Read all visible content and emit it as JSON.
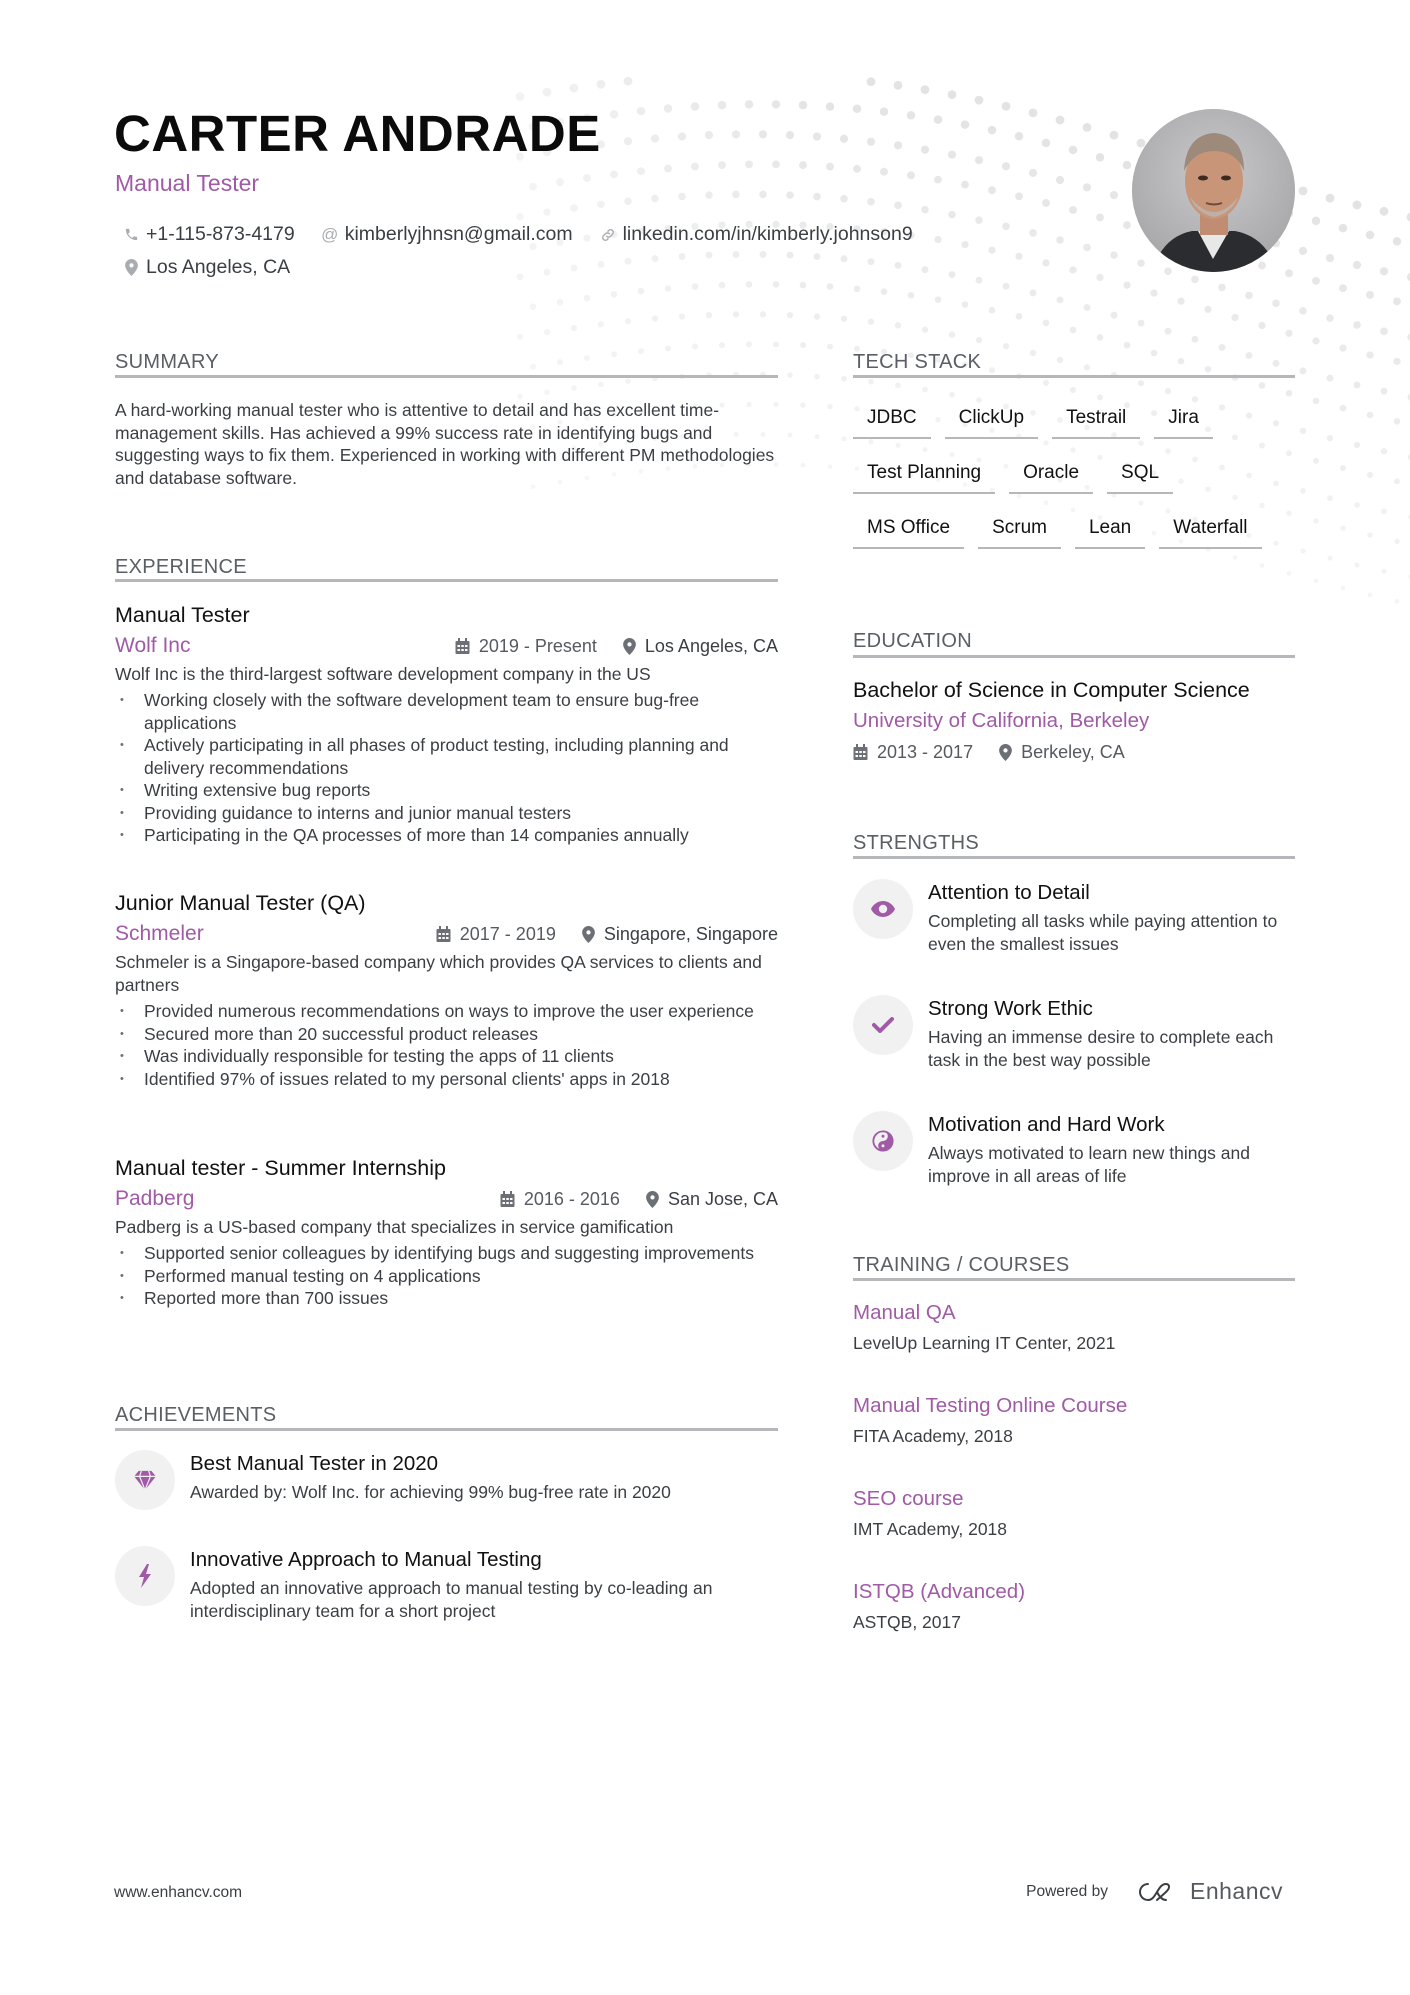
{
  "header": {
    "name": "CARTER ANDRADE",
    "title": "Manual Tester",
    "contacts": {
      "phone": "+1-115-873-4179",
      "email": "kimberlyjhnsn@gmail.com",
      "linkedin": "linkedin.com/in/kimberly.johnson9",
      "location": "Los Angeles, CA"
    },
    "photo_alt": "Profile photo"
  },
  "colors": {
    "accent": "#a05aa6",
    "heading_line": "#b5b7ba",
    "icon_circle": "#f1f1f2"
  },
  "summary": {
    "heading": "SUMMARY",
    "text": "A hard-working manual tester who is attentive to detail and has excellent time-management skills. Has achieved a 99% success rate in identifying bugs and suggesting ways to fix them. Experienced in working with different PM methodologies and database software."
  },
  "experience": {
    "heading": "EXPERIENCE",
    "items": [
      {
        "role": "Manual Tester",
        "company": "Wolf Inc",
        "dates": "2019 - Present",
        "location": "Los Angeles, CA",
        "description": "Wolf Inc is the third-largest software development company in the US",
        "bullets": [
          "Working closely with the software development team to ensure bug-free applications",
          "Actively participating in all phases of product testing, including planning and delivery recommendations",
          "Writing extensive bug reports",
          "Providing guidance to interns and junior manual testers",
          "Participating in the QA processes of more than 14 companies annually"
        ]
      },
      {
        "role": "Junior Manual Tester (QA)",
        "company": "Schmeler",
        "dates": "2017 - 2019",
        "location": "Singapore, Singapore",
        "description": "Schmeler is a Singapore-based company which provides QA services to clients and partners",
        "bullets": [
          "Provided numerous recommendations on ways to improve the user experience",
          "Secured more than 20 successful product releases",
          "Was individually responsible for testing the apps of 11 clients",
          "Identified 97% of issues related to my personal clients' apps in 2018"
        ]
      },
      {
        "role": "Manual tester - Summer Internship",
        "company": "Padberg",
        "dates": "2016 - 2016",
        "location": "San Jose, CA",
        "description": "Padberg is a US-based company that specializes in service gamification",
        "bullets": [
          "Supported senior colleagues by identifying bugs and suggesting improvements",
          "Performed manual testing on 4 applications",
          "Reported more than 700 issues"
        ]
      }
    ]
  },
  "achievements": {
    "heading": "ACHIEVEMENTS",
    "items": [
      {
        "icon": "diamond-icon",
        "title": "Best Manual Tester in 2020",
        "description": "Awarded by: Wolf Inc. for achieving 99% bug-free rate in 2020"
      },
      {
        "icon": "lightning-bolt-icon",
        "title": "Innovative Approach to Manual Testing",
        "description": "Adopted an innovative approach to manual testing by co-leading an interdisciplinary team for a short project"
      }
    ]
  },
  "tech_stack": {
    "heading": "TECH STACK",
    "rows": [
      [
        "JDBC",
        "ClickUp",
        "Testrail",
        "Jira"
      ],
      [
        "Test Planning",
        "Oracle",
        "SQL"
      ],
      [
        "MS Office",
        "Scrum",
        "Lean",
        "Waterfall"
      ]
    ]
  },
  "education": {
    "heading": "EDUCATION",
    "degree": "Bachelor of Science in Computer Science",
    "school": "University of California, Berkeley",
    "dates": "2013 - 2017",
    "location": "Berkeley, CA"
  },
  "strengths": {
    "heading": "STRENGTHS",
    "items": [
      {
        "icon": "eye-icon",
        "title": "Attention to Detail",
        "description": "Completing all tasks while paying attention to even the smallest issues"
      },
      {
        "icon": "checkmark-icon",
        "title": "Strong Work Ethic",
        "description": "Having an immense desire to complete each task in the best way possible"
      },
      {
        "icon": "yin-yang-icon",
        "title": "Motivation and Hard Work",
        "description": "Always motivated to learn new things and improve in all areas of life"
      }
    ]
  },
  "training": {
    "heading": "TRAINING / COURSES",
    "items": [
      {
        "title": "Manual QA",
        "subtitle": "LevelUp Learning IT Center, 2021"
      },
      {
        "title": "Manual Testing Online Course",
        "subtitle": "FITA Academy, 2018"
      },
      {
        "title": "SEO course",
        "subtitle": "IMT Academy, 2018"
      },
      {
        "title": "ISTQB (Advanced)",
        "subtitle": "ASTQB, 2017"
      }
    ]
  },
  "footer": {
    "website": "www.enhancv.com",
    "powered_by": "Powered by",
    "brand": "Enhancv"
  }
}
